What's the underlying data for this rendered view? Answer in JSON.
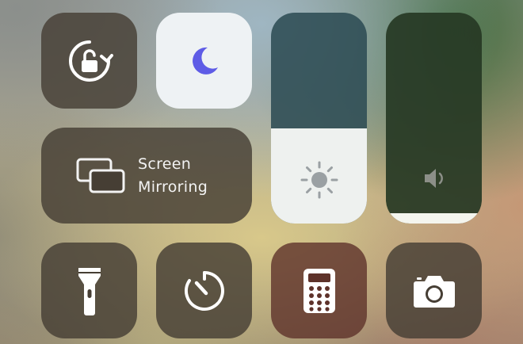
{
  "controls": {
    "rotation_lock": {
      "icon": "rotation-lock-icon"
    },
    "do_not_disturb": {
      "icon": "moon-icon",
      "state": "on",
      "accent": "#5e5ce6"
    },
    "screen_mirroring": {
      "label_line1": "Screen",
      "label_line2": "Mirroring",
      "icon": "screen-mirroring-icon"
    },
    "brightness": {
      "icon": "sun-icon",
      "level": 0.45
    },
    "volume": {
      "icon": "speaker-icon",
      "level": 0.05
    },
    "flashlight": {
      "icon": "flashlight-icon"
    },
    "timer": {
      "icon": "timer-icon"
    },
    "calculator": {
      "icon": "calculator-icon"
    },
    "camera": {
      "icon": "camera-icon"
    }
  }
}
